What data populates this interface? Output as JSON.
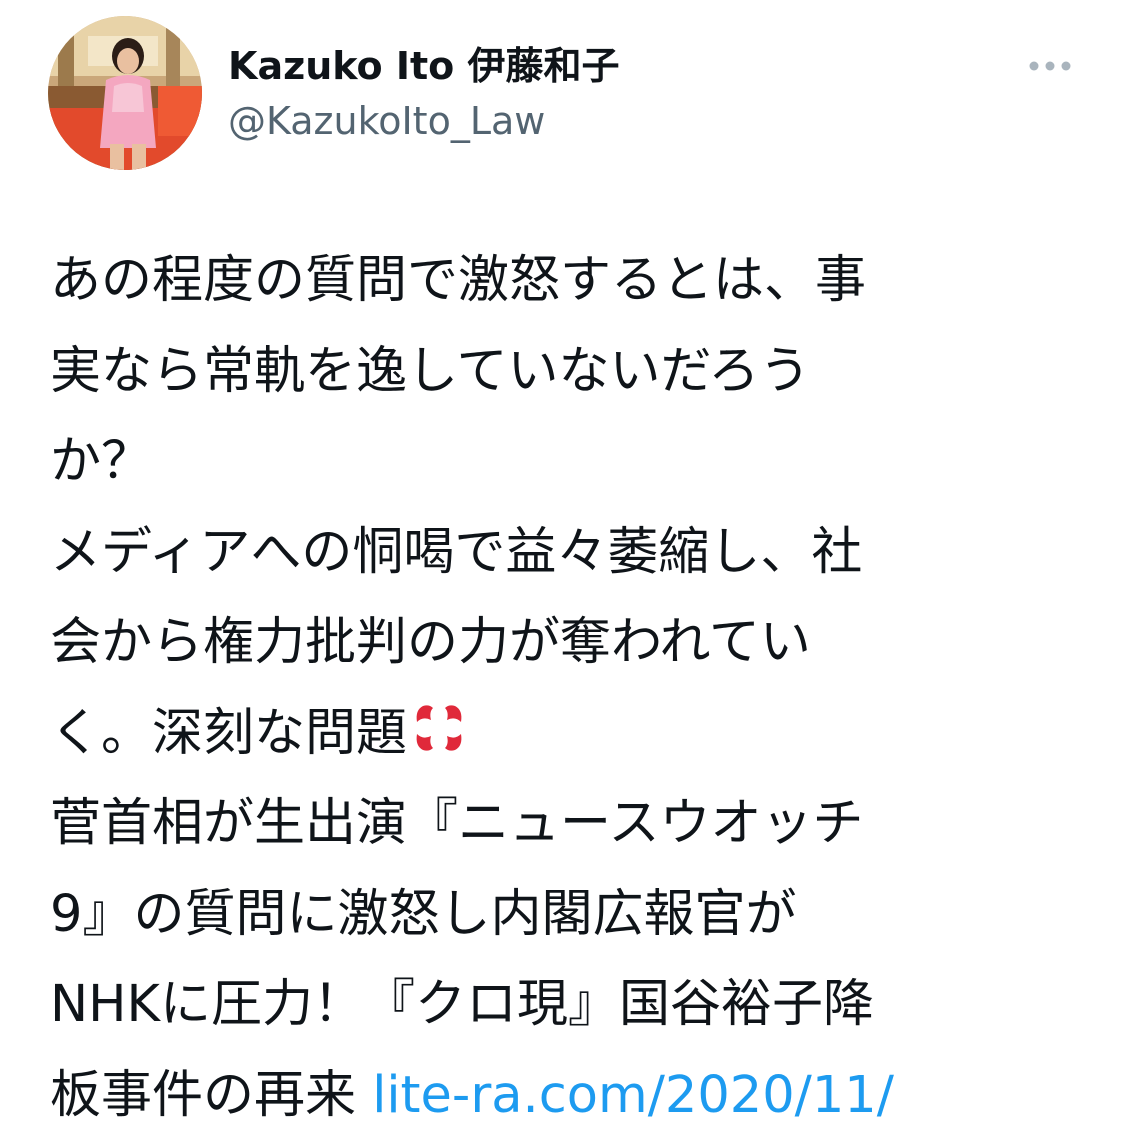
{
  "author": {
    "display_name": "Kazuko Ito 伊藤和子",
    "handle": "@KazukoIto_Law"
  },
  "tweet": {
    "lines": [
      "あの程度の質問で激怒するとは、事",
      "実なら常軌を逸していないだろう",
      "か？",
      "メディアへの恫喝で益々萎縮し、社",
      "会から権力批判の力が奪われてい",
      "く。深刻な問題",
      "菅首相が生出演『ニュースウオッチ",
      "9』の質問に激怒し内閣広報官が",
      "NHKに圧力！『クロ現』国谷裕子降"
    ],
    "last_line_text": "板事件の再来 ",
    "link_text": "lite-ra.com/2020/11/"
  },
  "icons": {
    "more": "more-horizontal-icon",
    "emoji": "anger-symbol-emoji"
  },
  "colors": {
    "text": "#0f1419",
    "secondary": "#536471",
    "link": "#1d9bf0",
    "emoji": "#e0293a"
  }
}
